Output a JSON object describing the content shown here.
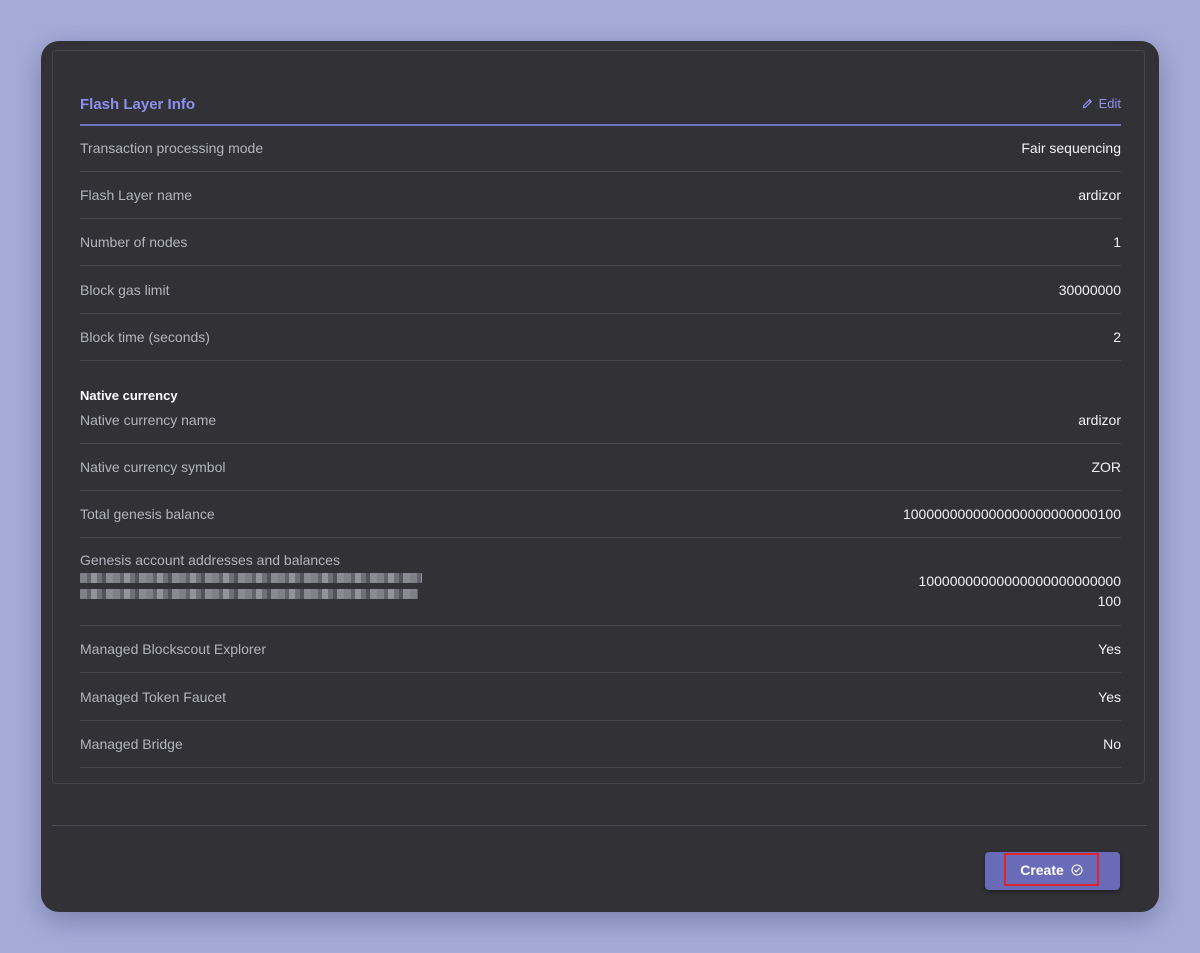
{
  "section": {
    "title": "Flash Layer Info",
    "edit_label": "Edit"
  },
  "rows": [
    {
      "label": "Transaction processing mode",
      "value": "Fair sequencing"
    },
    {
      "label": "Flash Layer name",
      "value": "ardizor"
    },
    {
      "label": "Number of nodes",
      "value": "1"
    },
    {
      "label": "Block gas limit",
      "value": "30000000"
    },
    {
      "label": "Block time (seconds)",
      "value": "2"
    }
  ],
  "native_currency": {
    "heading": "Native currency",
    "rows": [
      {
        "label": "Native currency name",
        "value": "ardizor"
      },
      {
        "label": "Native currency symbol",
        "value": "ZOR"
      },
      {
        "label": "Total genesis balance",
        "value": "1000000000000000000000000100"
      }
    ]
  },
  "genesis": {
    "label": "Genesis account addresses and balances",
    "value_line1": "10000000000000000000000000",
    "value_line2": "100"
  },
  "managed": [
    {
      "label": "Managed Blockscout Explorer",
      "value": "Yes"
    },
    {
      "label": "Managed Token Faucet",
      "value": "Yes"
    },
    {
      "label": "Managed Bridge",
      "value": "No"
    }
  ],
  "footer": {
    "create_label": "Create"
  },
  "colors": {
    "accent": "#8f8fef",
    "button": "#6a6bb8",
    "highlight": "#e0242c"
  },
  "icons": {
    "edit": "pencil-icon",
    "create": "check-circle-icon"
  }
}
